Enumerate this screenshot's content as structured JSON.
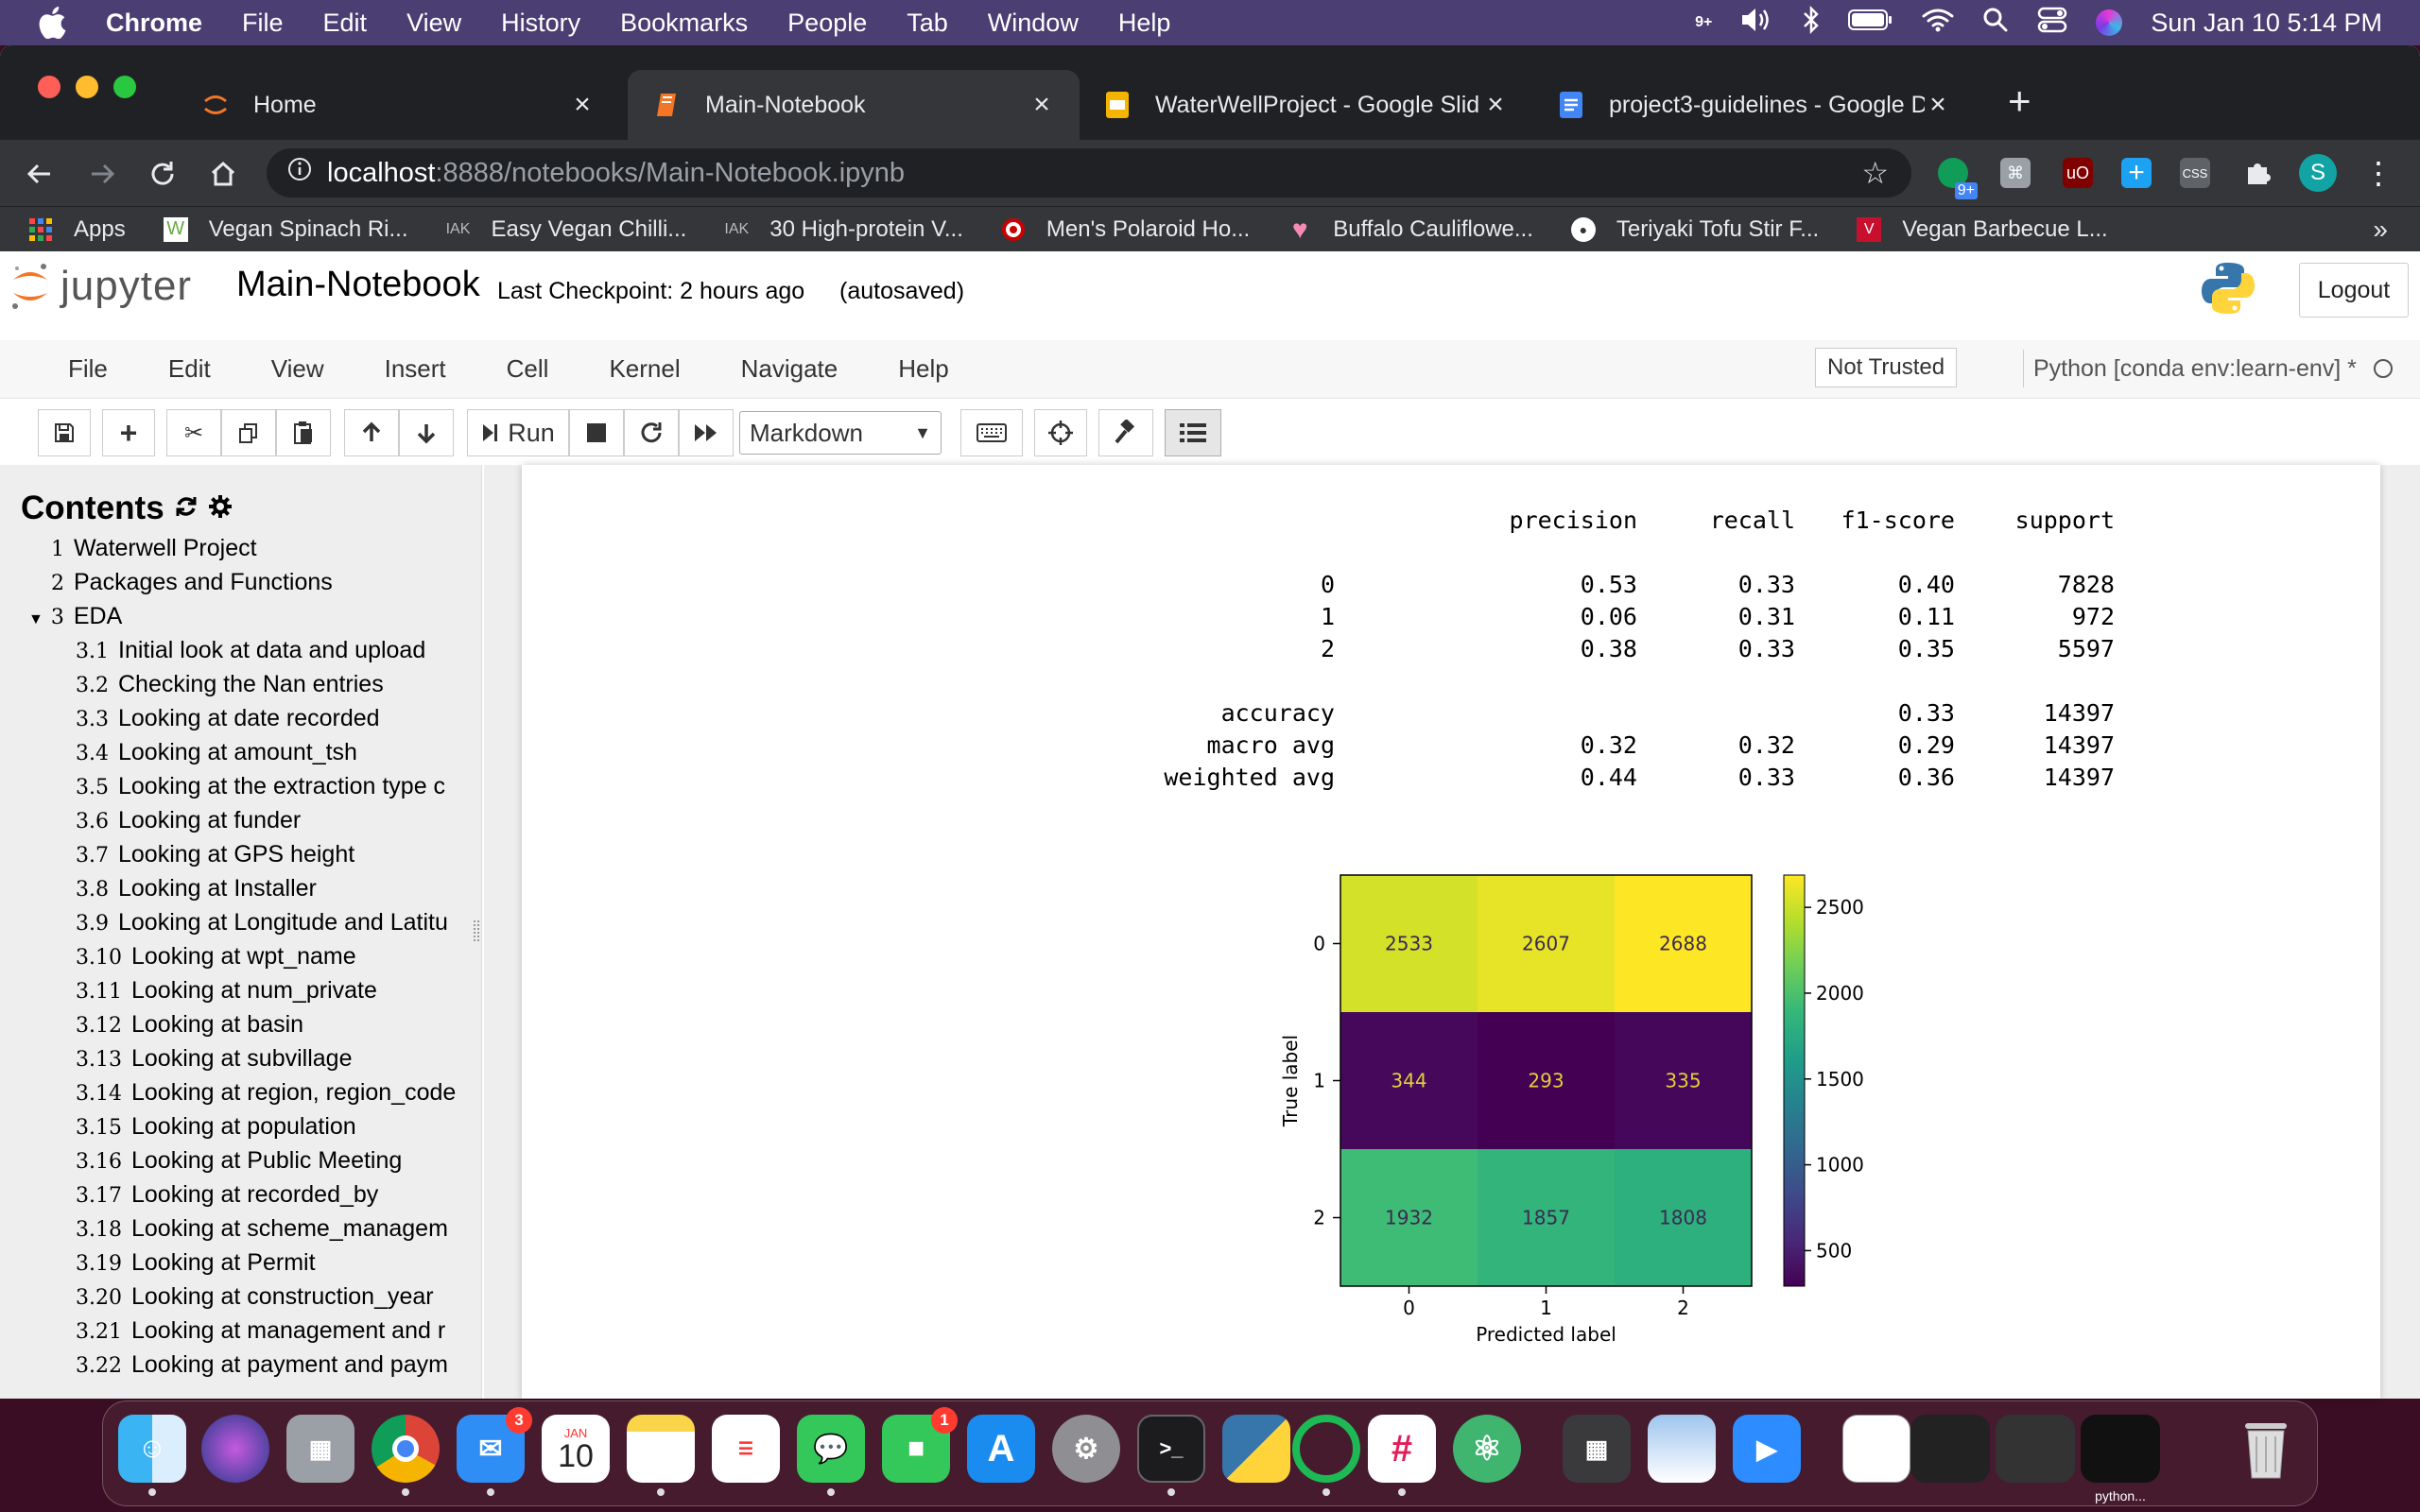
{
  "menubar": {
    "app": "Chrome",
    "items": [
      "File",
      "Edit",
      "View",
      "History",
      "Bookmarks",
      "People",
      "Tab",
      "Window",
      "Help"
    ],
    "clock": "Sun Jan 10  5:14 PM",
    "badge": "9+"
  },
  "tabs": [
    {
      "label": "Home"
    },
    {
      "label": "Main-Notebook"
    },
    {
      "label": "WaterWellProject - Google Slid"
    },
    {
      "label": "project3-guidelines - Google D"
    }
  ],
  "address": {
    "host": "localhost",
    "path": ":8888/notebooks/Main-Notebook.ipynb"
  },
  "extensions": {
    "badge": "9+",
    "avatar": "S",
    "css": "CSS"
  },
  "bookmarks": [
    {
      "label": "Apps"
    },
    {
      "label": "Vegan Spinach Ri..."
    },
    {
      "label": "Easy Vegan Chilli..."
    },
    {
      "label": "30 High-protein V..."
    },
    {
      "label": "Men's Polaroid Ho..."
    },
    {
      "label": "Buffalo Cauliflowe..."
    },
    {
      "label": "Teriyaki Tofu Stir F..."
    },
    {
      "label": "Vegan Barbecue L..."
    }
  ],
  "jupyter": {
    "logo_text": "jupyter",
    "notebook_name": "Main-Notebook",
    "checkpoint": "Last Checkpoint: 2 hours ago",
    "autosaved": "(autosaved)",
    "logout": "Logout",
    "menu": [
      "File",
      "Edit",
      "View",
      "Insert",
      "Cell",
      "Kernel",
      "Navigate",
      "Help"
    ],
    "trust": "Not Trusted",
    "kernel": "Python [conda env:learn-env] *",
    "run_label": "Run",
    "cell_type": "Markdown"
  },
  "toc": {
    "title": "Contents",
    "items": [
      {
        "num": "1",
        "label": "Waterwell Project",
        "level": 1
      },
      {
        "num": "2",
        "label": "Packages and Functions",
        "level": 1
      },
      {
        "num": "3",
        "label": "EDA",
        "level": 1,
        "expanded": true
      },
      {
        "num": "3.1",
        "label": "Initial look at data and upload",
        "level": 2
      },
      {
        "num": "3.2",
        "label": "Checking the Nan entries",
        "level": 2
      },
      {
        "num": "3.3",
        "label": "Looking at date recorded",
        "level": 2
      },
      {
        "num": "3.4",
        "label": "Looking at amount_tsh",
        "level": 2
      },
      {
        "num": "3.5",
        "label": "Looking at the extraction type c",
        "level": 2
      },
      {
        "num": "3.6",
        "label": "Looking at funder",
        "level": 2
      },
      {
        "num": "3.7",
        "label": "Looking at GPS height",
        "level": 2
      },
      {
        "num": "3.8",
        "label": "Looking at Installer",
        "level": 2
      },
      {
        "num": "3.9",
        "label": "Looking at Longitude and Latitu",
        "level": 2
      },
      {
        "num": "3.10",
        "label": "Looking at wpt_name",
        "level": 2
      },
      {
        "num": "3.11",
        "label": "Looking at num_private",
        "level": 2
      },
      {
        "num": "3.12",
        "label": "Looking at basin",
        "level": 2
      },
      {
        "num": "3.13",
        "label": "Looking at subvillage",
        "level": 2
      },
      {
        "num": "3.14",
        "label": "Looking at region, region_code",
        "level": 2
      },
      {
        "num": "3.15",
        "label": "Looking at population",
        "level": 2
      },
      {
        "num": "3.16",
        "label": "Looking at Public Meeting",
        "level": 2
      },
      {
        "num": "3.17",
        "label": "Looking at recorded_by",
        "level": 2
      },
      {
        "num": "3.18",
        "label": "Looking at scheme_managem",
        "level": 2
      },
      {
        "num": "3.19",
        "label": "Looking at Permit",
        "level": 2
      },
      {
        "num": "3.20",
        "label": "Looking at construction_year",
        "level": 2
      },
      {
        "num": "3.21",
        "label": "Looking at management and r",
        "level": 2
      },
      {
        "num": "3.22",
        "label": "Looking at payment and paym",
        "level": 2
      }
    ]
  },
  "report": {
    "headers": [
      "precision",
      "recall",
      "f1-score",
      "support"
    ],
    "rows": [
      {
        "label": "0",
        "precision": "0.53",
        "recall": "0.33",
        "f1": "0.40",
        "support": "7828"
      },
      {
        "label": "1",
        "precision": "0.06",
        "recall": "0.31",
        "f1": "0.11",
        "support": "972"
      },
      {
        "label": "2",
        "precision": "0.38",
        "recall": "0.33",
        "f1": "0.35",
        "support": "5597"
      }
    ],
    "summary": [
      {
        "label": "accuracy",
        "precision": "",
        "recall": "",
        "f1": "0.33",
        "support": "14397"
      },
      {
        "label": "macro avg",
        "precision": "0.32",
        "recall": "0.32",
        "f1": "0.29",
        "support": "14397"
      },
      {
        "label": "weighted avg",
        "precision": "0.44",
        "recall": "0.33",
        "f1": "0.36",
        "support": "14397"
      }
    ]
  },
  "chart_data": {
    "type": "heatmap",
    "xlabel": "Predicted label",
    "ylabel": "True label",
    "x_categories": [
      "0",
      "1",
      "2"
    ],
    "y_categories": [
      "0",
      "1",
      "2"
    ],
    "values": [
      [
        2533,
        2607,
        2688
      ],
      [
        344,
        293,
        335
      ],
      [
        1932,
        1857,
        1808
      ]
    ],
    "colormap": "viridis",
    "colorbar_ticks": [
      500,
      1000,
      1500,
      2000,
      2500
    ],
    "vmin": 293,
    "vmax": 2688
  },
  "dock": {
    "calendar_month": "JAN",
    "calendar_day": "10",
    "mail_badge": "3",
    "facetime_badge": "1",
    "last_label": "python..."
  }
}
